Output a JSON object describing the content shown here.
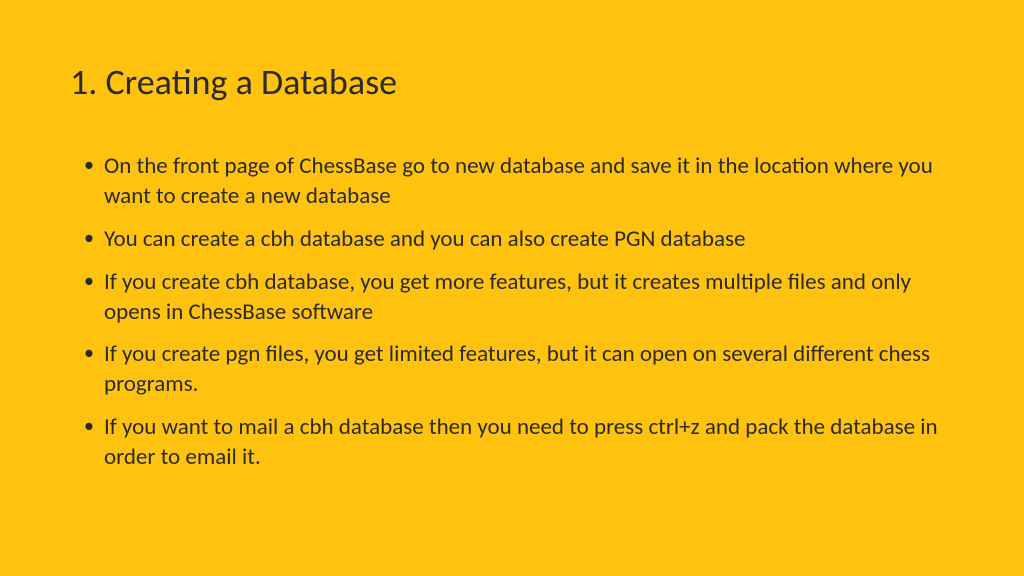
{
  "slide": {
    "title": "1. Creating a Database",
    "bullets": [
      "On the front page of ChessBase go to new database and save it in the location where you want to create a new database",
      "You can create a cbh database and you can also create PGN database",
      "If you create cbh database, you get more features, but it creates multiple files and only opens in ChessBase software",
      "If you create pgn files, you get limited features, but it can open on several different chess programs.",
      "If you want to mail a cbh database then you need to press ctrl+z and pack the database in order to email it."
    ]
  }
}
